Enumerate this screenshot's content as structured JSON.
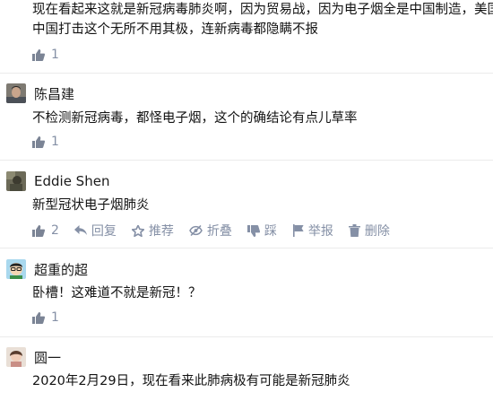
{
  "comments": [
    {
      "author": "",
      "text_lines": [
        "现在看起来这就是新冠病毒肺炎啊，因为贸易战，因为电子烟全是中国制造，美国为",
        "中国打击这个无所不用其极，连新病毒都隐瞒不报"
      ],
      "likes": "1"
    },
    {
      "author": "陈昌建",
      "text_lines": [
        "不检测新冠病毒，都怪电子烟，这个的确结论有点儿草率"
      ],
      "likes": "1"
    },
    {
      "author": "Eddie Shen",
      "text_lines": [
        "新型冠状电子烟肺炎"
      ],
      "likes": "2",
      "actions": {
        "reply": "回复",
        "recommend": "推荐",
        "collapse": "折叠",
        "dislike": "踩",
        "report": "举报",
        "delete": "删除"
      }
    },
    {
      "author": "超重的超",
      "text_lines": [
        "卧槽！这难道不就是新冠！？"
      ],
      "likes": "1"
    },
    {
      "author": "圆一",
      "text_lines": [
        "2020年2月29日，现在看来此肺病极有可能是新冠肺炎"
      ]
    }
  ],
  "icons": {
    "like": "thumbs-up-icon",
    "reply": "reply-arrow-icon",
    "recommend": "star-icon",
    "collapse": "eye-slash-icon",
    "dislike": "thumbs-down-icon",
    "report": "flag-icon",
    "delete": "trash-icon"
  },
  "colors": {
    "text": "#121212",
    "muted": "#8590a6",
    "like_icon": "#7b8495",
    "separator": "#ebebeb"
  }
}
